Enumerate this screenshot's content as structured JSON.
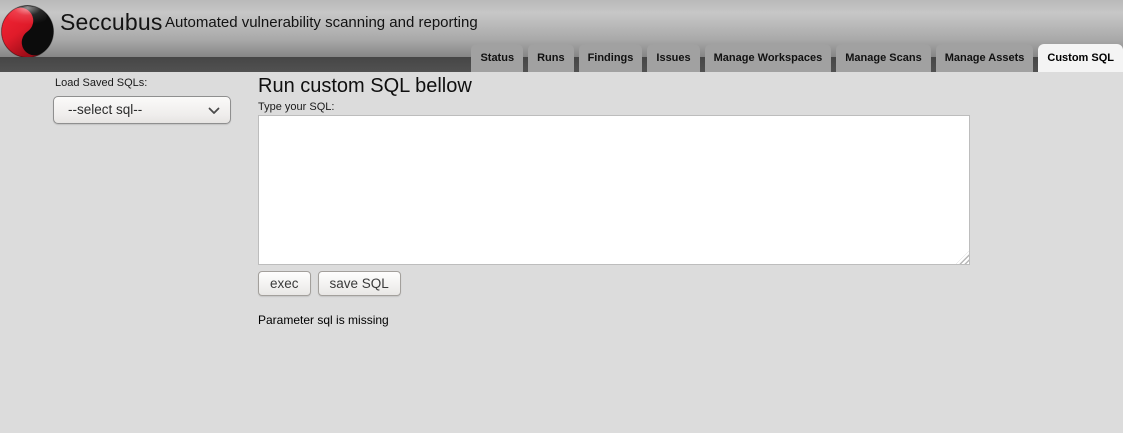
{
  "header": {
    "app_name": "Seccubus",
    "tagline": "Automated vulnerability scanning and reporting",
    "logo_icon": "seccubus-logo",
    "tabs": [
      {
        "label": "Status",
        "active": false
      },
      {
        "label": "Runs",
        "active": false
      },
      {
        "label": "Findings",
        "active": false
      },
      {
        "label": "Issues",
        "active": false
      },
      {
        "label": "Manage Workspaces",
        "active": false
      },
      {
        "label": "Manage Scans",
        "active": false
      },
      {
        "label": "Manage Assets",
        "active": false
      },
      {
        "label": "Custom SQL",
        "active": true
      }
    ]
  },
  "sidebar": {
    "load_label": "Load Saved SQLs:",
    "select": {
      "value": "--select sql--",
      "icon": "chevron-down-icon"
    }
  },
  "main": {
    "heading": "Run custom SQL bellow",
    "sql_label": "Type your SQL:",
    "sql_value": "",
    "buttons": {
      "exec": "exec",
      "save": "save SQL"
    },
    "status_message": "Parameter sql is missing"
  },
  "colors": {
    "brand_red": "#e01b2a",
    "header_strip": "#4b4b4b",
    "tab_inactive": "#a1a1a1",
    "tab_active": "#f4f4f4",
    "page_background": "#dcdcdc"
  }
}
